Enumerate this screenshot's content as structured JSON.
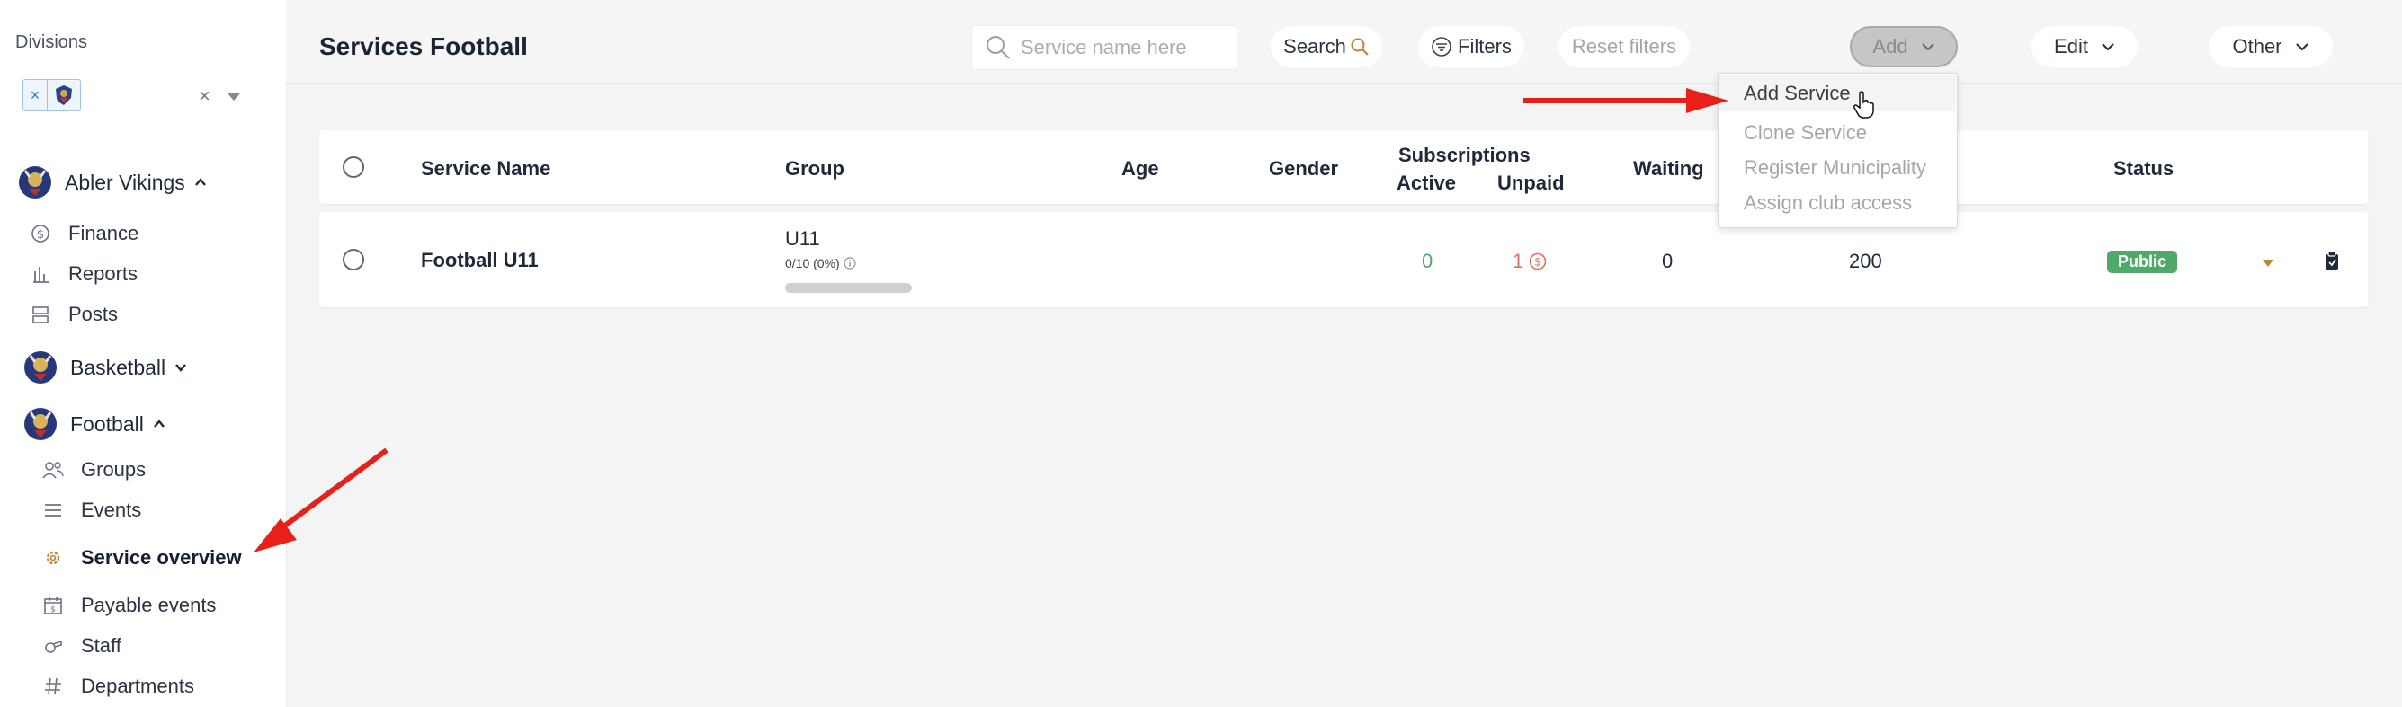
{
  "sidebar": {
    "divisions_label": "Divisions",
    "division_chip_remove": "×",
    "select_clear": "×",
    "clubs": [
      {
        "name": "Abler Vikings"
      },
      {
        "name": "Basketball"
      },
      {
        "name": "Football"
      }
    ],
    "abler_items": [
      {
        "label": "Finance",
        "icon": "dollar-circle-icon"
      },
      {
        "label": "Reports",
        "icon": "bar-chart-icon"
      },
      {
        "label": "Posts",
        "icon": "posts-icon"
      }
    ],
    "football_items": [
      {
        "label": "Groups",
        "icon": "users-icon"
      },
      {
        "label": "Events",
        "icon": "list-icon"
      },
      {
        "label": "Service overview",
        "icon": "gear-icon"
      },
      {
        "label": "Payable events",
        "icon": "calendar-dollar-icon"
      },
      {
        "label": "Staff",
        "icon": "whistle-icon"
      },
      {
        "label": "Departments",
        "icon": "hash-icon"
      }
    ]
  },
  "header": {
    "title": "Services Football",
    "search_placeholder": "Service name here",
    "search_label": "Search",
    "filters_label": "Filters",
    "reset_label": "Reset filters",
    "add_label": "Add",
    "edit_label": "Edit",
    "other_label": "Other"
  },
  "add_menu": {
    "items": [
      "Add Service",
      "Clone Service",
      "Register Municipality",
      "Assign club access"
    ]
  },
  "table": {
    "columns": {
      "service_name": "Service Name",
      "group": "Group",
      "age": "Age",
      "gender": "Gender",
      "subscriptions": "Subscriptions",
      "active": "Active",
      "unpaid": "Unpaid",
      "waiting": "Waiting",
      "status": "Status"
    },
    "rows": [
      {
        "service_name": "Football U11",
        "group": "U11",
        "group_capacity": "0/10 (0%)",
        "capacity_fraction": 0,
        "active": "0",
        "unpaid": "1",
        "waiting": "0",
        "amount": "200",
        "status": "Public"
      }
    ]
  },
  "colors": {
    "active_green": "#4fa96a",
    "unpaid_red": "#e0715a",
    "arrow_red": "#e8201a",
    "public_badge": "#4fa96a"
  }
}
